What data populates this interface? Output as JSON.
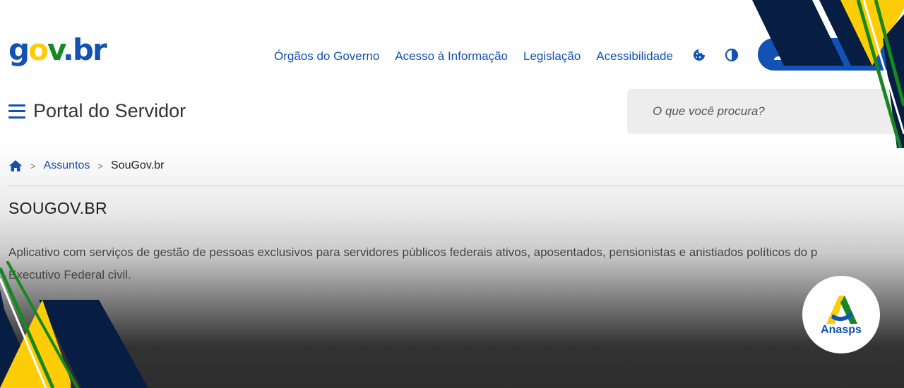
{
  "logo": {
    "g": "g",
    "o": "o",
    "v": "v",
    "dot": ".",
    "br": "br"
  },
  "top_nav": {
    "items": [
      "Órgãos do Governo",
      "Acesso à Informação",
      "Legislação",
      "Acessibilidade"
    ]
  },
  "utility_icons": [
    "cookie-icon",
    "contrast-icon"
  ],
  "login": {
    "icon": "user-icon"
  },
  "portal": {
    "title": "Portal do Servidor"
  },
  "search": {
    "placeholder": "O que você procura?"
  },
  "breadcrumb": {
    "home_icon": "home-icon",
    "separator": ">",
    "items": [
      "Assuntos",
      "SouGov.br"
    ]
  },
  "page": {
    "title": "SOUGOV.BR",
    "description_line1": "Aplicativo com serviços de gestão de pessoas exclusivos para servidores públicos federais ativos, aposentados, pensionistas e anistiados políticos do p",
    "description_line2": "Executivo Federal civil."
  },
  "badge": {
    "name": "Anasps"
  },
  "colors": {
    "primary_blue": "#1351b4",
    "navy": "#071d41",
    "yellow": "#ffcd07",
    "green": "#168821"
  }
}
